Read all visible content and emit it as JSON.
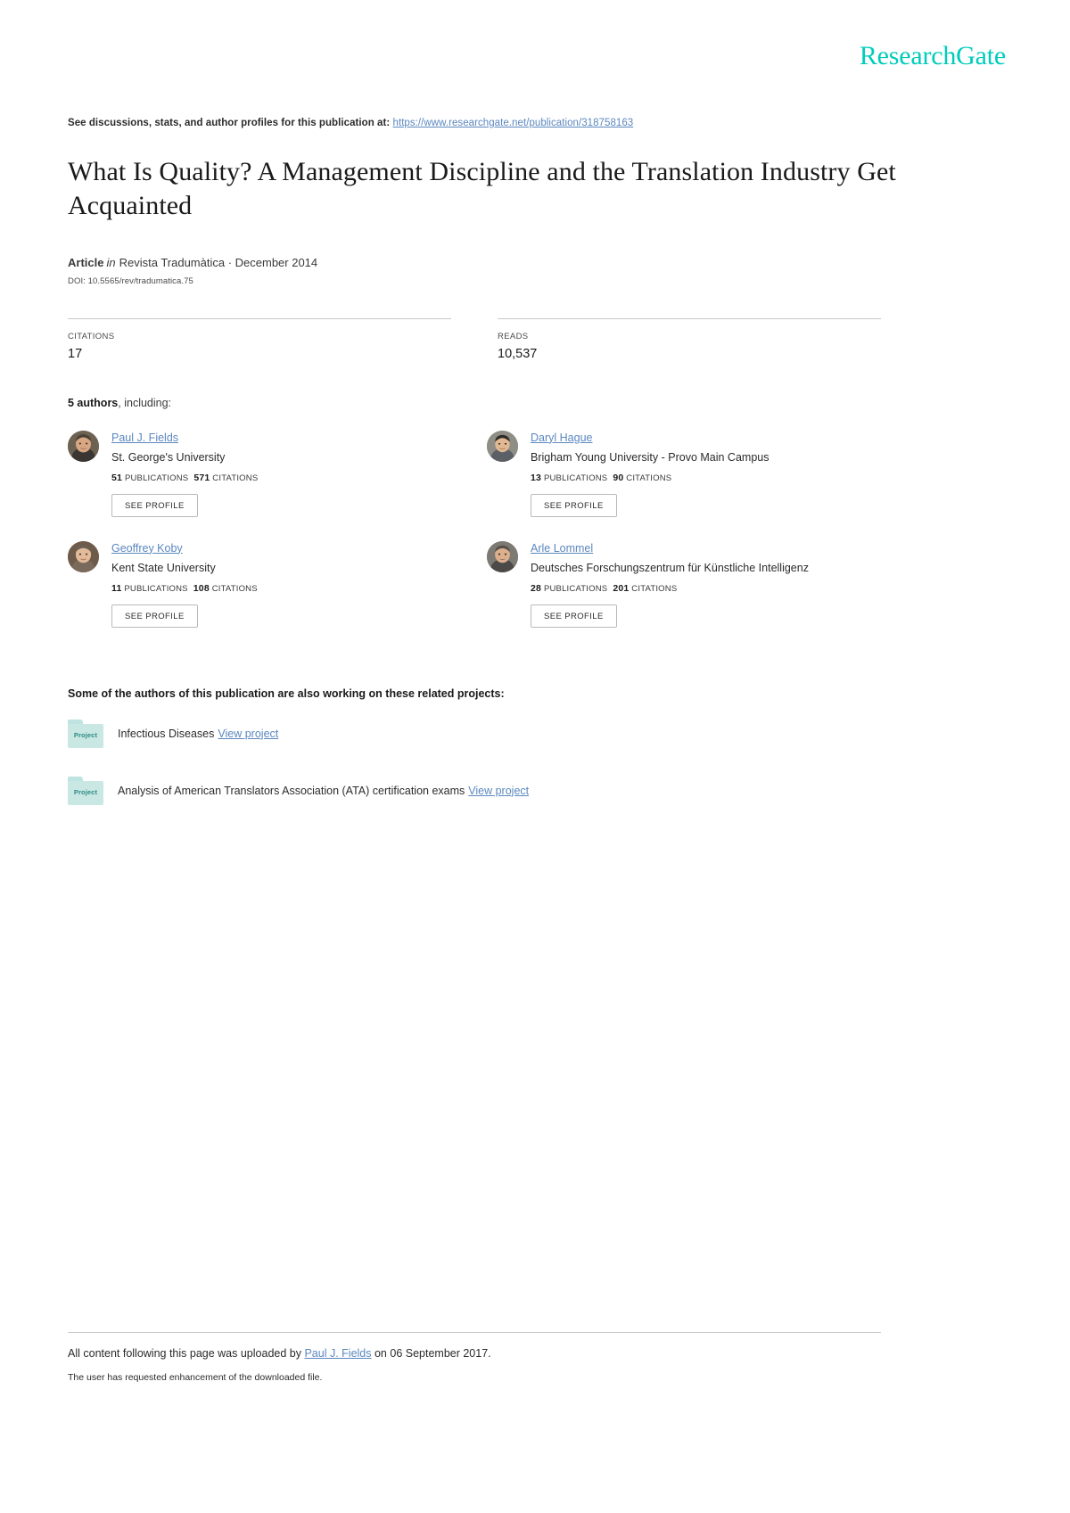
{
  "brand": {
    "logo_text": "ResearchGate",
    "accent_color": "#00ccbb",
    "link_color": "#5b87bf"
  },
  "header": {
    "discussion_prefix": "See discussions, stats, and author profiles for this publication at:",
    "publication_url": "https://www.researchgate.net/publication/318758163"
  },
  "publication": {
    "title": "What Is Quality? A Management Discipline and the Translation Industry Get Acquainted",
    "type_label": "Article",
    "in_label": "in",
    "venue": "Revista Tradumàtica · December 2014",
    "doi": "DOI: 10.5565/rev/tradumatica.75"
  },
  "stats": {
    "citations_label": "CITATIONS",
    "citations_value": "17",
    "reads_label": "READS",
    "reads_value": "10,537"
  },
  "authors_section": {
    "count_text": "5 authors",
    "including_text": ", including:",
    "see_profile_label": "SEE PROFILE",
    "publications_label": "PUBLICATIONS",
    "citations_label": "CITATIONS",
    "authors": [
      {
        "name": "Paul J. Fields",
        "affiliation": "St. George's University",
        "publications": "51",
        "citations": "571"
      },
      {
        "name": "Daryl Hague",
        "affiliation": "Brigham Young University - Provo Main Campus",
        "publications": "13",
        "citations": "90"
      },
      {
        "name": "Geoffrey Koby",
        "affiliation": "Kent State University",
        "publications": "11",
        "citations": "108"
      },
      {
        "name": "Arle Lommel",
        "affiliation": "Deutsches Forschungszentrum für Künstliche Intelligenz",
        "publications": "28",
        "citations": "201"
      }
    ]
  },
  "projects_section": {
    "heading": "Some of the authors of this publication are also working on these related projects:",
    "folder_label": "Project",
    "view_label": "View project",
    "projects": [
      {
        "title": "Infectious Diseases"
      },
      {
        "title": "Analysis of American Translators Association (ATA) certification exams"
      }
    ]
  },
  "footer": {
    "uploaded_prefix": "All content following this page was uploaded by",
    "uploader": "Paul J. Fields",
    "uploaded_suffix": "on 06 September 2017.",
    "enhancement_note": "The user has requested enhancement of the downloaded file."
  }
}
